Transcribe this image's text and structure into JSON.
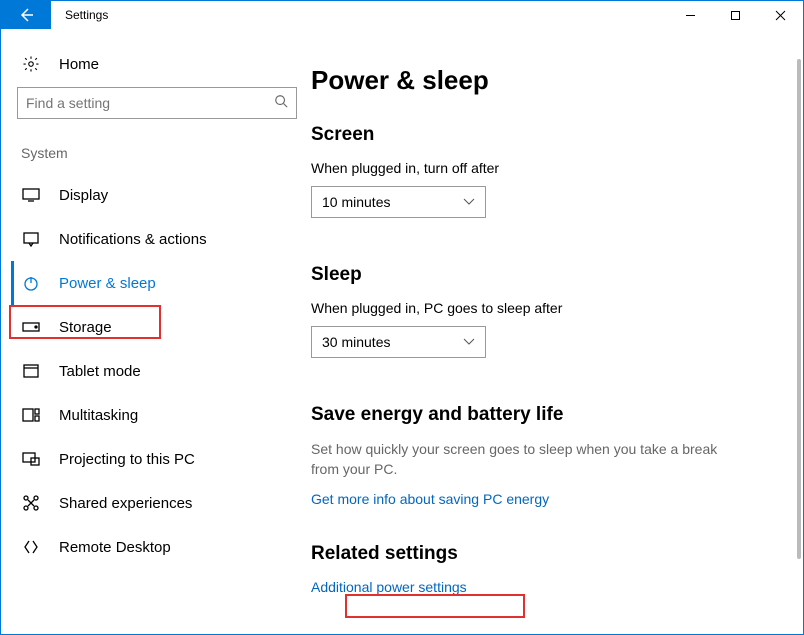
{
  "titlebar": {
    "title": "Settings"
  },
  "sidebar": {
    "home": "Home",
    "search_placeholder": "Find a setting",
    "group": "System",
    "items": [
      {
        "id": "display",
        "label": "Display"
      },
      {
        "id": "notifications",
        "label": "Notifications & actions"
      },
      {
        "id": "power-sleep",
        "label": "Power & sleep",
        "active": true
      },
      {
        "id": "storage",
        "label": "Storage"
      },
      {
        "id": "tablet",
        "label": "Tablet mode"
      },
      {
        "id": "multitasking",
        "label": "Multitasking"
      },
      {
        "id": "projecting",
        "label": "Projecting to this PC"
      },
      {
        "id": "shared",
        "label": "Shared experiences"
      },
      {
        "id": "remote",
        "label": "Remote Desktop"
      }
    ]
  },
  "main": {
    "title": "Power & sleep",
    "screen": {
      "heading": "Screen",
      "label": "When plugged in, turn off after",
      "value": "10 minutes"
    },
    "sleep": {
      "heading": "Sleep",
      "label": "When plugged in, PC goes to sleep after",
      "value": "30 minutes"
    },
    "energy": {
      "heading": "Save energy and battery life",
      "desc": "Set how quickly your screen goes to sleep when you take a break from your PC.",
      "link": "Get more info about saving PC energy"
    },
    "related": {
      "heading": "Related settings",
      "link": "Additional power settings"
    }
  }
}
